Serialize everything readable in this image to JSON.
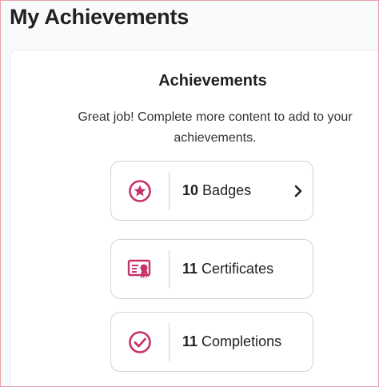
{
  "page": {
    "title": "My Achievements"
  },
  "achievements": {
    "heading": "Achievements",
    "message": "Great job! Complete more content to add to your achievements.",
    "accent_color": "#c8326b",
    "items": [
      {
        "count": "10",
        "label": "Badges",
        "icon": "star-badge-icon",
        "has_chevron": true
      },
      {
        "count": "11",
        "label": "Certificates",
        "icon": "certificate-icon",
        "has_chevron": false
      },
      {
        "count": "11",
        "label": "Completions",
        "icon": "check-circle-icon",
        "has_chevron": false
      }
    ]
  }
}
